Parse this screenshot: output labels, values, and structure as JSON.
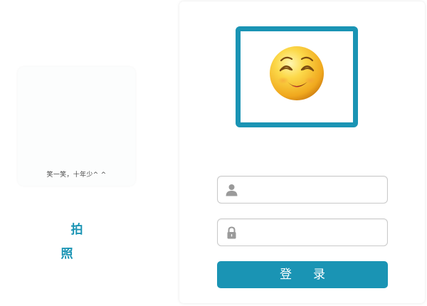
{
  "photo": {
    "caption": "笑一笑，十年少^ ^"
  },
  "capture": {
    "label": "拍照"
  },
  "login_form": {
    "avatar_icon": "smiling-emoji-icon",
    "username": {
      "icon": "user-icon",
      "value": "",
      "placeholder": ""
    },
    "password": {
      "icon": "lock-icon",
      "value": "",
      "placeholder": ""
    },
    "submit_label": "登录"
  },
  "colors": {
    "accent": "#1a94b4",
    "field_border": "#c9c9c9",
    "icon_gray": "#9a9a9a"
  }
}
